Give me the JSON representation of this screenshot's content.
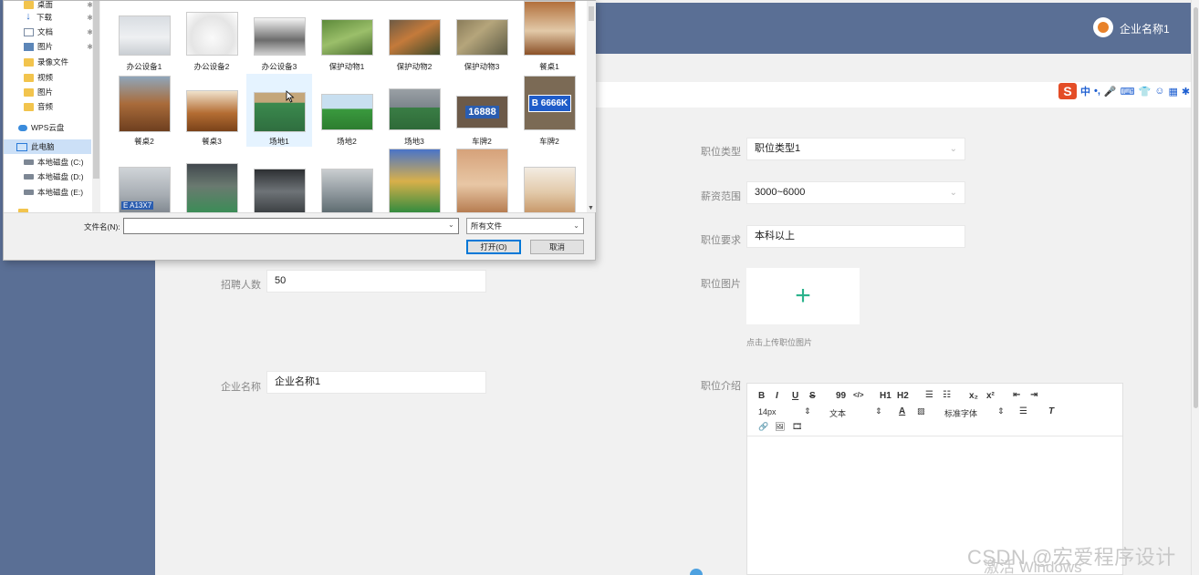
{
  "header": {
    "company_name": "企业名称1"
  },
  "ime_toolbar": {
    "logo": "S",
    "items": [
      "中",
      "•,",
      "🎤",
      "⌨",
      "👕",
      "☺",
      "▦",
      "✱"
    ]
  },
  "form": {
    "position_type": {
      "label": "职位类型",
      "value": "职位类型1"
    },
    "salary_range": {
      "label": "薪资范围",
      "value": "3000~6000"
    },
    "requirement": {
      "label": "职位要求",
      "value": "本科以上"
    },
    "headcount": {
      "label": "招聘人数",
      "value": "50"
    },
    "position_image": {
      "label": "职位图片",
      "hint": "点击上传职位图片",
      "plus": "+"
    },
    "company_name": {
      "label": "企业名称",
      "value": "企业名称1"
    },
    "intro": {
      "label": "职位介绍"
    }
  },
  "editor_toolbar": {
    "row1": [
      "B",
      "I",
      "U",
      "S",
      "99",
      "</>",
      "H1",
      "H2",
      "☰",
      "☷",
      "x₂",
      "x²",
      "⇤",
      "⇥"
    ],
    "font_size": "14px",
    "text_style": "文本",
    "font_family": "标准字体",
    "row3": [
      "🔗",
      "🖼",
      "🎞"
    ]
  },
  "dialog": {
    "nav_items": [
      {
        "label": "桌面",
        "icon": "desktop-folder-icon"
      },
      {
        "label": "下载",
        "icon": "download-icon"
      },
      {
        "label": "文档",
        "icon": "document-icon"
      },
      {
        "label": "图片",
        "icon": "picture-icon"
      },
      {
        "label": "录像文件",
        "icon": "folder-icon"
      },
      {
        "label": "视频",
        "icon": "folder-icon"
      },
      {
        "label": "图片",
        "icon": "folder-icon"
      },
      {
        "label": "音频",
        "icon": "folder-icon"
      },
      {
        "label": "WPS云盘",
        "icon": "cloud-icon"
      },
      {
        "label": "此电脑",
        "icon": "pc-icon"
      },
      {
        "label": "本地磁盘 (C:)",
        "icon": "disk-icon"
      },
      {
        "label": "本地磁盘 (D:)",
        "icon": "disk-icon"
      },
      {
        "label": "本地磁盘 (E:)",
        "icon": "disk-icon"
      }
    ],
    "files": [
      "办公设备1",
      "办公设备2",
      "办公设备3",
      "保护动物1",
      "保护动物2",
      "保护动物3",
      "餐桌1",
      "餐桌2",
      "餐桌3",
      "场地1",
      "场地2",
      "场地3",
      "车牌2",
      "车牌2",
      "",
      "",
      "",
      "",
      "",
      "",
      ""
    ],
    "plate_text_1": "16888",
    "plate_text_2": "B 6666K",
    "plate_text_3": "E A13X7",
    "filename_label": "文件名(N):",
    "filename_value": "",
    "filetype_value": "所有文件",
    "open_label": "打开(O)",
    "cancel_label": "取消"
  },
  "watermark": {
    "csdn": "CSDN @宏爱程序设计",
    "windows": "激活 Windows"
  },
  "colors": {
    "sidebar": "#5a6f95",
    "accent_green": "#2bb38c",
    "dialog_selection": "#cce0f7"
  }
}
